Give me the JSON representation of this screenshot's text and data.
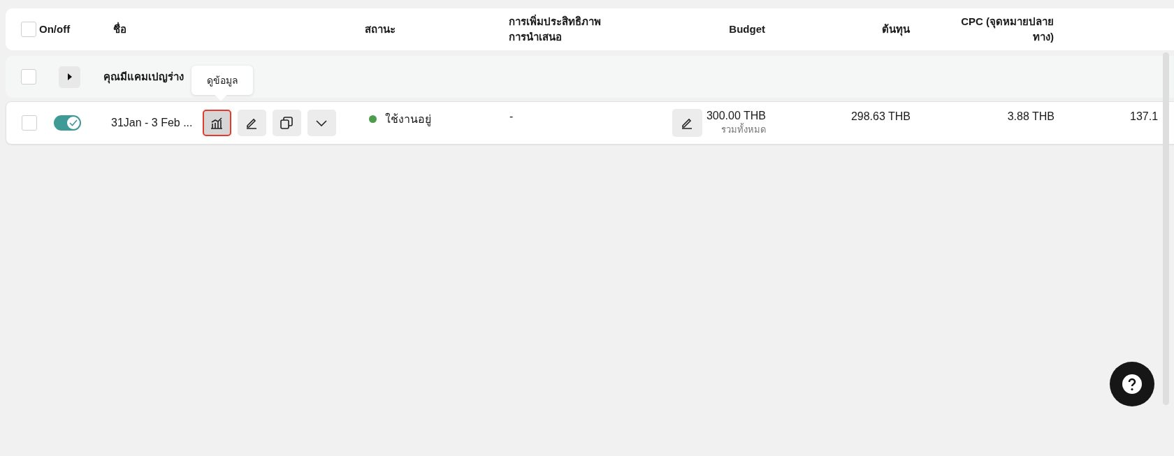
{
  "header": {
    "select_all_checked": false,
    "columns": [
      {
        "kind": "onoff",
        "lines": [
          "On/off"
        ]
      },
      {
        "kind": "name",
        "lines": [
          "ชื่อ"
        ]
      },
      {
        "kind": "status",
        "lines": [
          "สถานะ"
        ]
      },
      {
        "kind": "optimization",
        "lines": [
          "การเพิ่มประสิทธิภาพ",
          "การนำเสนอ"
        ]
      },
      {
        "kind": "budget",
        "lines": [
          "Budget"
        ]
      },
      {
        "kind": "cost",
        "lines": [
          "ต้นทุน"
        ]
      },
      {
        "kind": "cpc",
        "lines": [
          "CPC (จุดหมายปลาย",
          "ทาง)"
        ]
      }
    ]
  },
  "group": {
    "checked": false,
    "expanded": false,
    "title": "คุณมีแคมเปญร่าง"
  },
  "rows": [
    {
      "checked": false,
      "on": true,
      "name": "31Jan - 3 Feb ...",
      "actions": [
        {
          "kind": "chart",
          "highlighted": true
        },
        {
          "kind": "edit",
          "highlighted": false
        },
        {
          "kind": "copy",
          "highlighted": false
        },
        {
          "kind": "more",
          "highlighted": false
        }
      ],
      "status": {
        "label": "ใช้งานอยู่",
        "color": "#4c9e4c"
      },
      "optimization": "-",
      "budget": "300.00 THB",
      "budget_note": "รวมทั้งหมด",
      "cost": "298.63 THB",
      "cpc": "3.88 THB",
      "column_9": "137.1"
    }
  ],
  "tooltip": {
    "text": "ดูข้อมูล"
  }
}
